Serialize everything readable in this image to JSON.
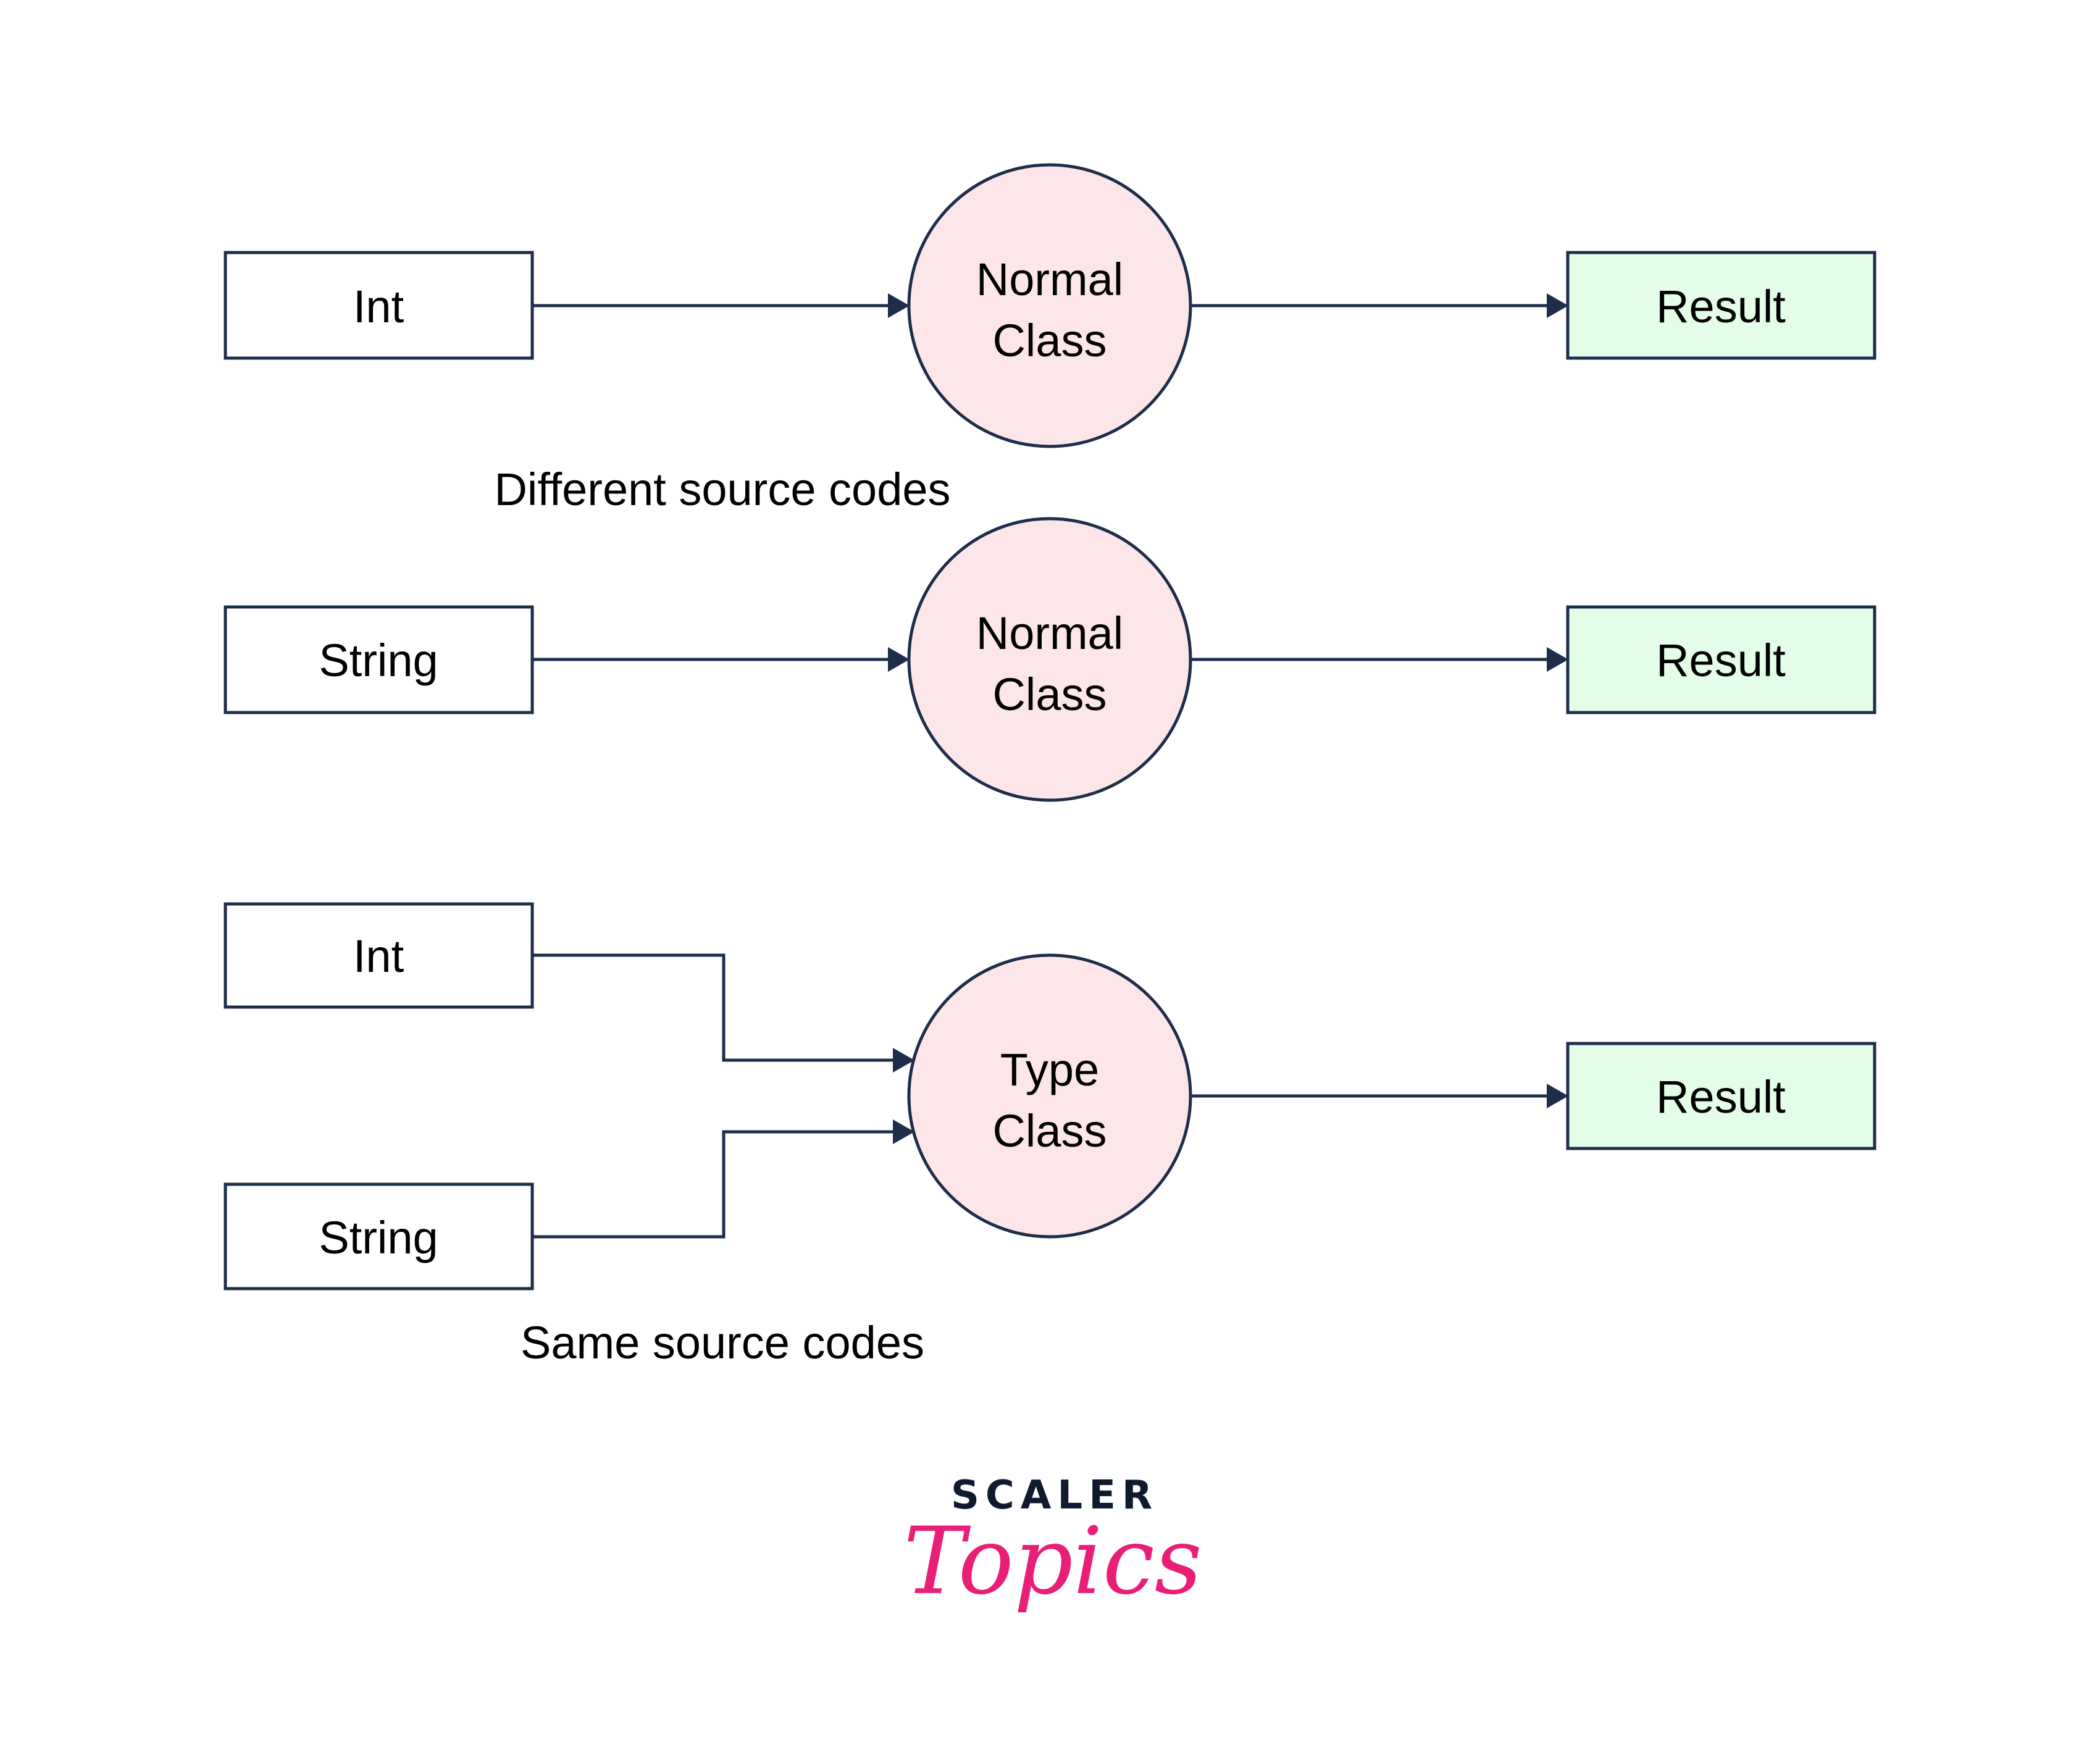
{
  "colors": {
    "stroke": "#1e2d4a",
    "input_fill": "#ffffff",
    "class_fill": "#fde6e9",
    "result_fill": "#e3fde9",
    "logo_dark": "#0f1a2e",
    "logo_pink": "#e91e77"
  },
  "rows": [
    {
      "inputs": [
        "Int"
      ],
      "node": [
        "Normal",
        "Class"
      ],
      "result": "Result"
    },
    {
      "inputs": [
        "String"
      ],
      "node": [
        "Normal",
        "Class"
      ],
      "result": "Result"
    },
    {
      "inputs": [
        "Int",
        "String"
      ],
      "node": [
        "Type",
        "Class"
      ],
      "result": "Result"
    }
  ],
  "captions": {
    "different": "Different source codes",
    "same": "Same source codes"
  },
  "logo": {
    "top": "SCALER",
    "bottom": "Topics"
  }
}
